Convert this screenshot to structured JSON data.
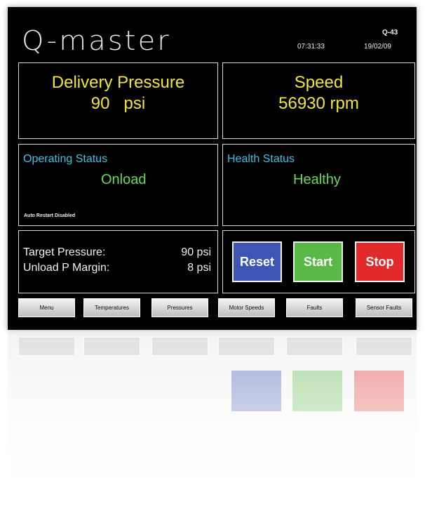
{
  "header": {
    "logo": "Q-master",
    "time": "07:31:33",
    "unit_id": "Q-43",
    "date": "19/02/09"
  },
  "delivery": {
    "title": "Delivery Pressure",
    "value": "90   psi"
  },
  "speed": {
    "title": "Speed",
    "value": "56930 rpm"
  },
  "operating_status": {
    "label": "Operating Status",
    "value": "Onload",
    "note": "Auto Restart Disabled"
  },
  "health_status": {
    "label": "Health Status",
    "value": "Healthy"
  },
  "params": {
    "target_label": "Target Pressure:",
    "target_value": "90 psi",
    "unload_label": "Unload P Margin:",
    "unload_value": "8 psi"
  },
  "buttons": {
    "reset": "Reset",
    "start": "Start",
    "stop": "Stop"
  },
  "nav": [
    "Menu",
    "Temperatures",
    "Pressures",
    "Motor Speeds",
    "Faults",
    "Sensor Faults"
  ],
  "colors": {
    "title_yellow": "#f2e43a",
    "status_blue": "#3ec0e8",
    "status_green": "#6cd85a",
    "reset": "#3d56b4",
    "start": "#5ab946",
    "stop": "#e22a2a"
  }
}
